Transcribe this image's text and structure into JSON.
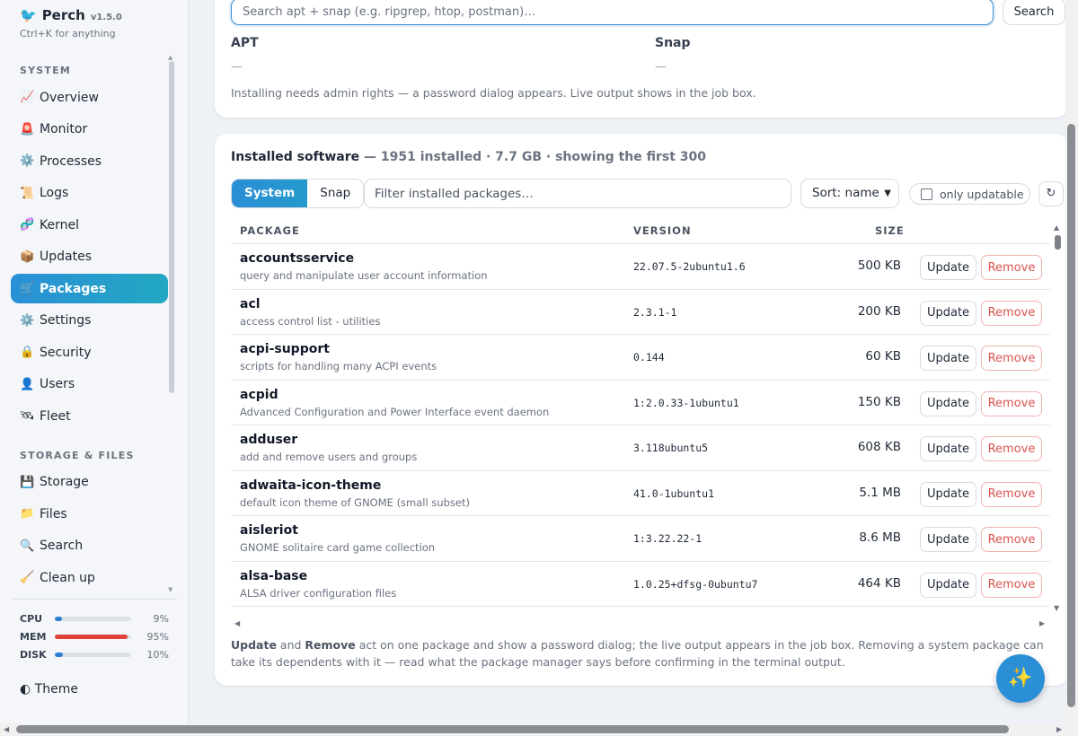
{
  "brand": {
    "logo": "🐦",
    "name": "Perch",
    "version": "v1.5.0",
    "hint": "Ctrl+K for anything"
  },
  "sidebar": {
    "sections": [
      {
        "title": "SYSTEM",
        "items": [
          {
            "icon": "📈",
            "icon_name": "chart-icon",
            "label": "Overview"
          },
          {
            "icon": "🚨",
            "icon_name": "alarm-icon",
            "label": "Monitor"
          },
          {
            "icon": "⚙️",
            "icon_name": "gear-icon",
            "label": "Processes"
          },
          {
            "icon": "📜",
            "icon_name": "scroll-icon",
            "label": "Logs"
          },
          {
            "icon": "🧬",
            "icon_name": "dna-icon",
            "label": "Kernel"
          },
          {
            "icon": "📦",
            "icon_name": "package-icon",
            "label": "Updates"
          },
          {
            "icon": "🛒",
            "icon_name": "cart-icon",
            "label": "Packages",
            "active": true
          },
          {
            "icon": "⚙️",
            "icon_name": "gear-icon",
            "label": "Settings"
          },
          {
            "icon": "🔒",
            "icon_name": "lock-icon",
            "label": "Security"
          },
          {
            "icon": "👤",
            "icon_name": "user-icon",
            "label": "Users"
          },
          {
            "icon": "🛰",
            "icon_name": "satellite-icon",
            "label": "Fleet"
          }
        ]
      },
      {
        "title": "STORAGE & FILES",
        "items": [
          {
            "icon": "💾",
            "icon_name": "disk-icon",
            "label": "Storage"
          },
          {
            "icon": "📁",
            "icon_name": "folder-icon",
            "label": "Files"
          },
          {
            "icon": "🔍",
            "icon_name": "search-icon",
            "label": "Search"
          },
          {
            "icon": "🧹",
            "icon_name": "broom-icon",
            "label": "Clean up"
          }
        ]
      }
    ],
    "meters": [
      {
        "label": "CPU",
        "value": "9%",
        "level": 0.09,
        "color": "#2f7fd1"
      },
      {
        "label": "MEM",
        "value": "95%",
        "level": 0.95,
        "color": "#e0413a"
      },
      {
        "label": "DISK",
        "value": "10%",
        "level": 0.1,
        "color": "#2f7fd1"
      }
    ],
    "theme_label": "◐ Theme"
  },
  "install": {
    "search_placeholder": "Search apt + snap (e.g. ripgrep, htop, postman)…",
    "search_button": "Search",
    "apt_heading": "APT",
    "apt_value": "—",
    "snap_heading": "Snap",
    "snap_value": "—",
    "note": "Installing needs admin rights — a password dialog appears. Live output shows in the job box."
  },
  "installed": {
    "title": "Installed software",
    "summary": "— 1951 installed · 7.7 GB · showing the first 300",
    "tabs": [
      {
        "label": "System",
        "active": true
      },
      {
        "label": "Snap",
        "active": false
      }
    ],
    "filter_placeholder": "Filter installed packages…",
    "sort_value": "Sort: name",
    "only_updatable_label": "only updatable",
    "refresh_icon": "↻",
    "columns": {
      "package": "PACKAGE",
      "version": "VERSION",
      "size": "SIZE"
    },
    "update_label": "Update",
    "remove_label": "Remove",
    "rows": [
      {
        "name": "accountsservice",
        "desc": "query and manipulate user account information",
        "version": "22.07.5-2ubuntu1.6",
        "size": "500 KB"
      },
      {
        "name": "acl",
        "desc": "access control list - utilities",
        "version": "2.3.1-1",
        "size": "200 KB"
      },
      {
        "name": "acpi-support",
        "desc": "scripts for handling many ACPI events",
        "version": "0.144",
        "size": "60 KB"
      },
      {
        "name": "acpid",
        "desc": "Advanced Configuration and Power Interface event daemon",
        "version": "1:2.0.33-1ubuntu1",
        "size": "150 KB"
      },
      {
        "name": "adduser",
        "desc": "add and remove users and groups",
        "version": "3.118ubuntu5",
        "size": "608 KB"
      },
      {
        "name": "adwaita-icon-theme",
        "desc": "default icon theme of GNOME (small subset)",
        "version": "41.0-1ubuntu1",
        "size": "5.1 MB"
      },
      {
        "name": "aisleriot",
        "desc": "GNOME solitaire card game collection",
        "version": "1:3.22.22-1",
        "size": "8.6 MB"
      },
      {
        "name": "alsa-base",
        "desc": "ALSA driver configuration files",
        "version": "1.0.25+dfsg-0ubuntu7",
        "size": "464 KB"
      }
    ],
    "footer_update": "Update",
    "footer_and": " and ",
    "footer_remove": "Remove",
    "footer_text": " act on one package and show a password dialog; the live output appears in the job box. Removing a system package can take its dependents with it — read what the package manager says before confirming in the terminal output."
  },
  "fab_icon": "✨"
}
